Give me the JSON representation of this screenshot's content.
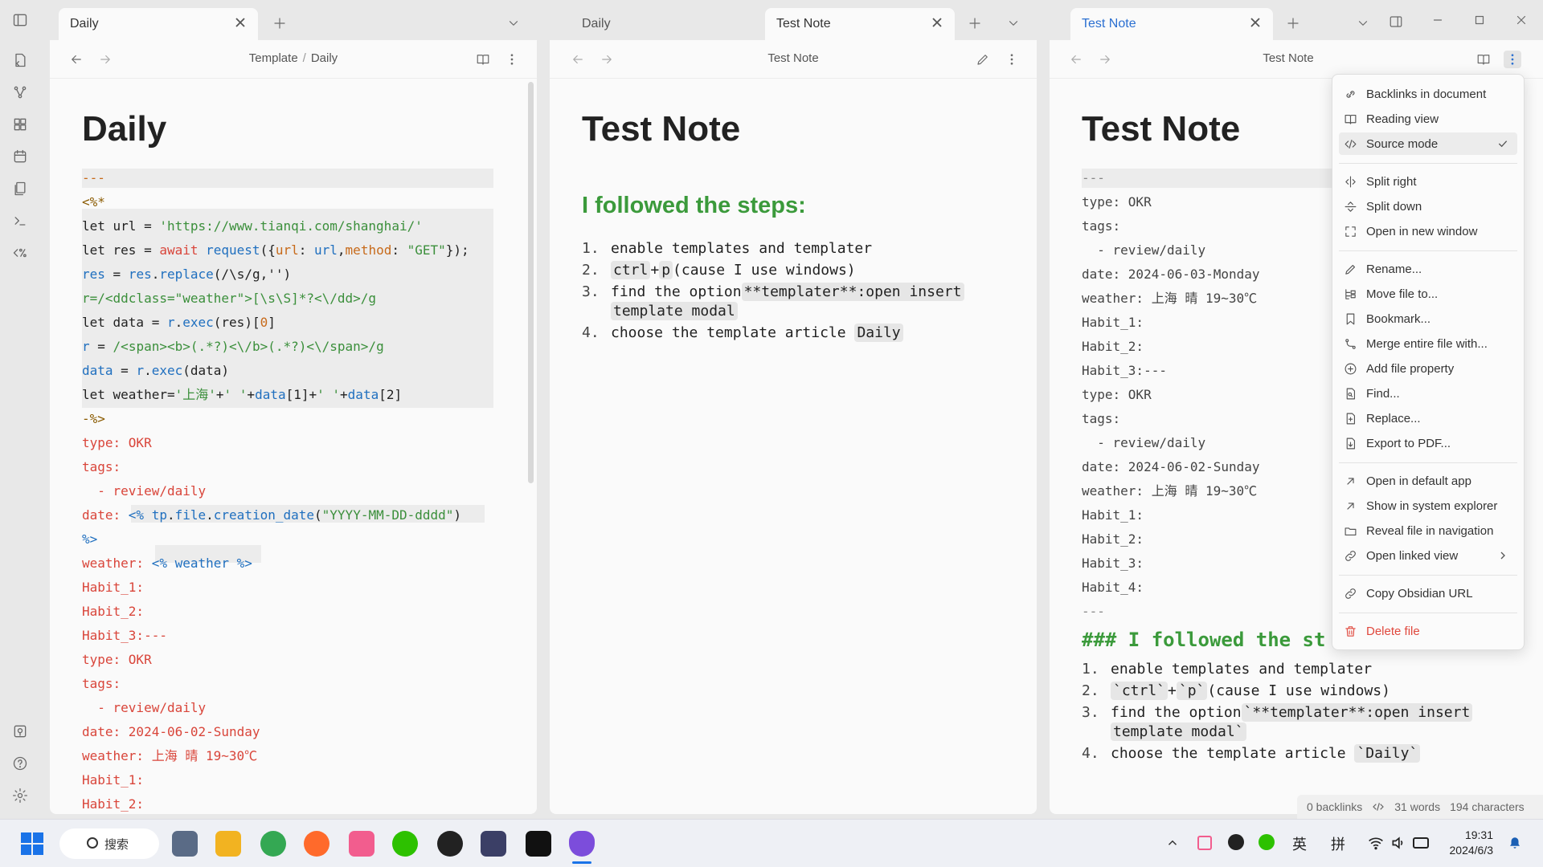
{
  "tabs": {
    "left": {
      "label": "Daily"
    },
    "middle_inactive": {
      "label": "Daily"
    },
    "middle_active": {
      "label": "Test Note"
    },
    "right_active": {
      "label": "Test Note"
    }
  },
  "left_pane": {
    "breadcrumb": [
      "Template",
      "Daily"
    ],
    "heading": "Daily",
    "lines": [
      {
        "segs": [
          {
            "t": "---",
            "c": "org"
          }
        ]
      },
      {
        "segs": [
          {
            "t": "<%*",
            "c": "brn"
          }
        ]
      },
      {
        "segs": [
          {
            "t": "let url = ",
            "c": ""
          },
          {
            "t": "'https://www.tianqi.com/shanghai/'",
            "c": "grn"
          }
        ]
      },
      {
        "segs": [
          {
            "t": "let res = ",
            "c": ""
          },
          {
            "t": "await",
            "c": "red"
          },
          {
            "t": " request",
            "c": "blu"
          },
          {
            "t": "({",
            "c": ""
          },
          {
            "t": "url",
            "c": "org"
          },
          {
            "t": ": ",
            "c": ""
          },
          {
            "t": "url",
            "c": "blu"
          },
          {
            "t": ",",
            "c": ""
          },
          {
            "t": "method",
            "c": "org"
          },
          {
            "t": ": ",
            "c": ""
          },
          {
            "t": "\"GET\"",
            "c": "grn"
          },
          {
            "t": "});",
            "c": ""
          }
        ]
      },
      {
        "segs": [
          {
            "t": "res",
            "c": "blu"
          },
          {
            "t": " = ",
            "c": ""
          },
          {
            "t": "res",
            "c": "blu"
          },
          {
            "t": ".",
            "c": ""
          },
          {
            "t": "replace",
            "c": "blu"
          },
          {
            "t": "(/\\s/g,'')",
            "c": ""
          }
        ]
      },
      {
        "segs": [
          {
            "t": "r=/<ddclass=\"weather\">[\\s\\S]*?<\\/dd>/g",
            "c": "grn"
          }
        ]
      },
      {
        "segs": [
          {
            "t": "let data = ",
            "c": ""
          },
          {
            "t": "r",
            "c": "blu"
          },
          {
            "t": ".",
            "c": ""
          },
          {
            "t": "exec",
            "c": "blu"
          },
          {
            "t": "(res)[",
            "c": ""
          },
          {
            "t": "0",
            "c": "org"
          },
          {
            "t": "]",
            "c": ""
          }
        ]
      },
      {
        "segs": [
          {
            "t": "r",
            "c": "blu"
          },
          {
            "t": " = ",
            "c": ""
          },
          {
            "t": "/<span><b>(.*?)<\\/b>(.*?)<\\/span>/g",
            "c": "grn"
          }
        ]
      },
      {
        "segs": [
          {
            "t": "data",
            "c": "blu"
          },
          {
            "t": " = ",
            "c": ""
          },
          {
            "t": "r",
            "c": "blu"
          },
          {
            "t": ".",
            "c": ""
          },
          {
            "t": "exec",
            "c": "blu"
          },
          {
            "t": "(data)",
            "c": ""
          }
        ]
      },
      {
        "segs": [
          {
            "t": "let weather=",
            "c": ""
          },
          {
            "t": "'上海'",
            "c": "grn"
          },
          {
            "t": "+",
            "c": ""
          },
          {
            "t": "' '",
            "c": "grn"
          },
          {
            "t": "+",
            "c": ""
          },
          {
            "t": "data",
            "c": "blu"
          },
          {
            "t": "[1]+",
            "c": ""
          },
          {
            "t": "' '",
            "c": "grn"
          },
          {
            "t": "+",
            "c": ""
          },
          {
            "t": "data",
            "c": "blu"
          },
          {
            "t": "[2]",
            "c": ""
          }
        ]
      },
      {
        "segs": [
          {
            "t": "-%>",
            "c": "brn"
          }
        ]
      },
      {
        "segs": [
          {
            "t": "type: OKR",
            "c": "red"
          }
        ]
      },
      {
        "segs": [
          {
            "t": "tags:",
            "c": "red"
          }
        ]
      },
      {
        "segs": [
          {
            "t": "  - review/daily",
            "c": "red"
          }
        ]
      },
      {
        "segs": [
          {
            "t": "date: ",
            "c": "red"
          },
          {
            "t": "<% ",
            "c": "blu"
          },
          {
            "t": "tp",
            "c": "blu"
          },
          {
            "t": ".",
            "c": ""
          },
          {
            "t": "file",
            "c": "blu"
          },
          {
            "t": ".",
            "c": ""
          },
          {
            "t": "creation_date",
            "c": "blu"
          },
          {
            "t": "(",
            "c": ""
          },
          {
            "t": "\"YYYY-MM-DD-dddd\"",
            "c": "grn"
          },
          {
            "t": ")",
            "c": ""
          }
        ]
      },
      {
        "segs": [
          {
            "t": "%>",
            "c": "blu"
          }
        ]
      },
      {
        "segs": [
          {
            "t": "weather: ",
            "c": "red"
          },
          {
            "t": "<% weather %>",
            "c": "blu"
          }
        ]
      },
      {
        "segs": [
          {
            "t": "Habit_1:",
            "c": "red"
          }
        ]
      },
      {
        "segs": [
          {
            "t": "Habit_2:",
            "c": "red"
          }
        ]
      },
      {
        "segs": [
          {
            "t": "Habit_3:---",
            "c": "red"
          }
        ]
      },
      {
        "segs": [
          {
            "t": "type: OKR",
            "c": "red"
          }
        ]
      },
      {
        "segs": [
          {
            "t": "tags:",
            "c": "red"
          }
        ]
      },
      {
        "segs": [
          {
            "t": "  - review/daily",
            "c": "red"
          }
        ]
      },
      {
        "segs": [
          {
            "t": "date: 2024-06-02-Sunday",
            "c": "red"
          }
        ]
      },
      {
        "segs": [
          {
            "t": "weather: 上海 晴 19~30℃",
            "c": "red"
          }
        ]
      },
      {
        "segs": [
          {
            "t": "Habit_1:",
            "c": "red"
          }
        ]
      },
      {
        "segs": [
          {
            "t": "Habit_2:",
            "c": "red"
          }
        ]
      }
    ]
  },
  "middle_pane": {
    "title": "Test Note",
    "heading": "Test Note",
    "subheading": "I followed the steps:",
    "steps": [
      {
        "n": "1.",
        "parts": [
          {
            "t": "enable templates and templater",
            "chip": false
          }
        ]
      },
      {
        "n": "2.",
        "parts": [
          {
            "t": "ctrl",
            "chip": true
          },
          {
            "t": "+",
            "chip": false
          },
          {
            "t": "p",
            "chip": true
          },
          {
            "t": "(cause I use windows)",
            "chip": false
          }
        ]
      },
      {
        "n": "3.",
        "parts": [
          {
            "t": "find the option",
            "chip": false
          },
          {
            "t": "**templater**:open insert",
            "chip": true
          }
        ]
      },
      {
        "n": "",
        "parts": [
          {
            "t": "template modal",
            "chip": true
          }
        ]
      },
      {
        "n": "4.",
        "parts": [
          {
            "t": "choose the template article ",
            "chip": false
          },
          {
            "t": "Daily",
            "chip": true
          }
        ]
      }
    ]
  },
  "right_pane": {
    "title": "Test Note",
    "heading": "Test Note",
    "lines": [
      {
        "t": "---",
        "c": "gry"
      },
      {
        "t": "type: OKR",
        "c": ""
      },
      {
        "t": "tags:",
        "c": ""
      },
      {
        "t": "  - review/daily",
        "c": ""
      },
      {
        "t": "date: 2024-06-03-Monday",
        "c": ""
      },
      {
        "t": "weather: 上海 晴 19~30℃",
        "c": ""
      },
      {
        "t": "Habit_1:",
        "c": ""
      },
      {
        "t": "Habit_2:",
        "c": ""
      },
      {
        "t": "Habit_3:---",
        "c": ""
      },
      {
        "t": "type: OKR",
        "c": ""
      },
      {
        "t": "tags:",
        "c": ""
      },
      {
        "t": "  - review/daily",
        "c": ""
      },
      {
        "t": "date: 2024-06-02-Sunday",
        "c": ""
      },
      {
        "t": "weather: 上海 晴 19~30℃",
        "c": ""
      },
      {
        "t": "Habit_1:",
        "c": ""
      },
      {
        "t": "Habit_2:",
        "c": ""
      },
      {
        "t": "Habit_3:",
        "c": ""
      },
      {
        "t": "Habit_4:",
        "c": ""
      },
      {
        "t": "---",
        "c": "gry"
      }
    ],
    "source_heading": "### I followed the st",
    "steps": [
      {
        "n": "1.",
        "parts": [
          {
            "t": "enable templates and templater",
            "chip": false
          }
        ]
      },
      {
        "n": "2.",
        "parts": [
          {
            "t": "`ctrl`",
            "chip": true
          },
          {
            "t": "+",
            "chip": false
          },
          {
            "t": "`p`",
            "chip": true
          },
          {
            "t": "(cause I use windows)",
            "chip": false
          }
        ]
      },
      {
        "n": "3.",
        "parts": [
          {
            "t": "find the option",
            "chip": false
          },
          {
            "t": "`**templater**:open insert",
            "chip": true
          }
        ]
      },
      {
        "n": "",
        "parts": [
          {
            "t": "template modal`",
            "chip": true
          }
        ]
      },
      {
        "n": "4.",
        "parts": [
          {
            "t": "choose the template article ",
            "chip": false
          },
          {
            "t": "`Daily`",
            "chip": true
          }
        ]
      }
    ]
  },
  "menu": {
    "groups": [
      [
        {
          "label": "Backlinks in document",
          "icon": "backlinks-icon"
        },
        {
          "label": "Reading view",
          "icon": "book-icon"
        },
        {
          "label": "Source mode",
          "icon": "code-icon",
          "selected": true
        }
      ],
      [
        {
          "label": "Split right",
          "icon": "split-right-icon"
        },
        {
          "label": "Split down",
          "icon": "split-down-icon"
        },
        {
          "label": "Open in new window",
          "icon": "new-window-icon"
        }
      ],
      [
        {
          "label": "Rename...",
          "icon": "pencil-icon"
        },
        {
          "label": "Move file to...",
          "icon": "move-icon"
        },
        {
          "label": "Bookmark...",
          "icon": "bookmark-icon"
        },
        {
          "label": "Merge entire file with...",
          "icon": "merge-icon"
        },
        {
          "label": "Add file property",
          "icon": "plus-circle-icon"
        },
        {
          "label": "Find...",
          "icon": "find-icon"
        },
        {
          "label": "Replace...",
          "icon": "replace-icon"
        },
        {
          "label": "Export to PDF...",
          "icon": "export-icon"
        }
      ],
      [
        {
          "label": "Open in default app",
          "icon": "arrow-up-right-icon"
        },
        {
          "label": "Show in system explorer",
          "icon": "arrow-up-right-icon"
        },
        {
          "label": "Reveal file in navigation",
          "icon": "folder-icon"
        },
        {
          "label": "Open linked view",
          "icon": "link-icon",
          "submenu": true
        }
      ],
      [
        {
          "label": "Copy Obsidian URL",
          "icon": "link-icon"
        }
      ],
      [
        {
          "label": "Delete file",
          "icon": "trash-icon",
          "danger": true
        }
      ]
    ]
  },
  "status": {
    "backlinks": "0 backlinks",
    "words": "31 words",
    "chars": "194 characters"
  },
  "taskbar": {
    "search": "搜索",
    "time": "19:31",
    "date": "2024/6/3",
    "ime1": "英",
    "ime2": "拼"
  }
}
